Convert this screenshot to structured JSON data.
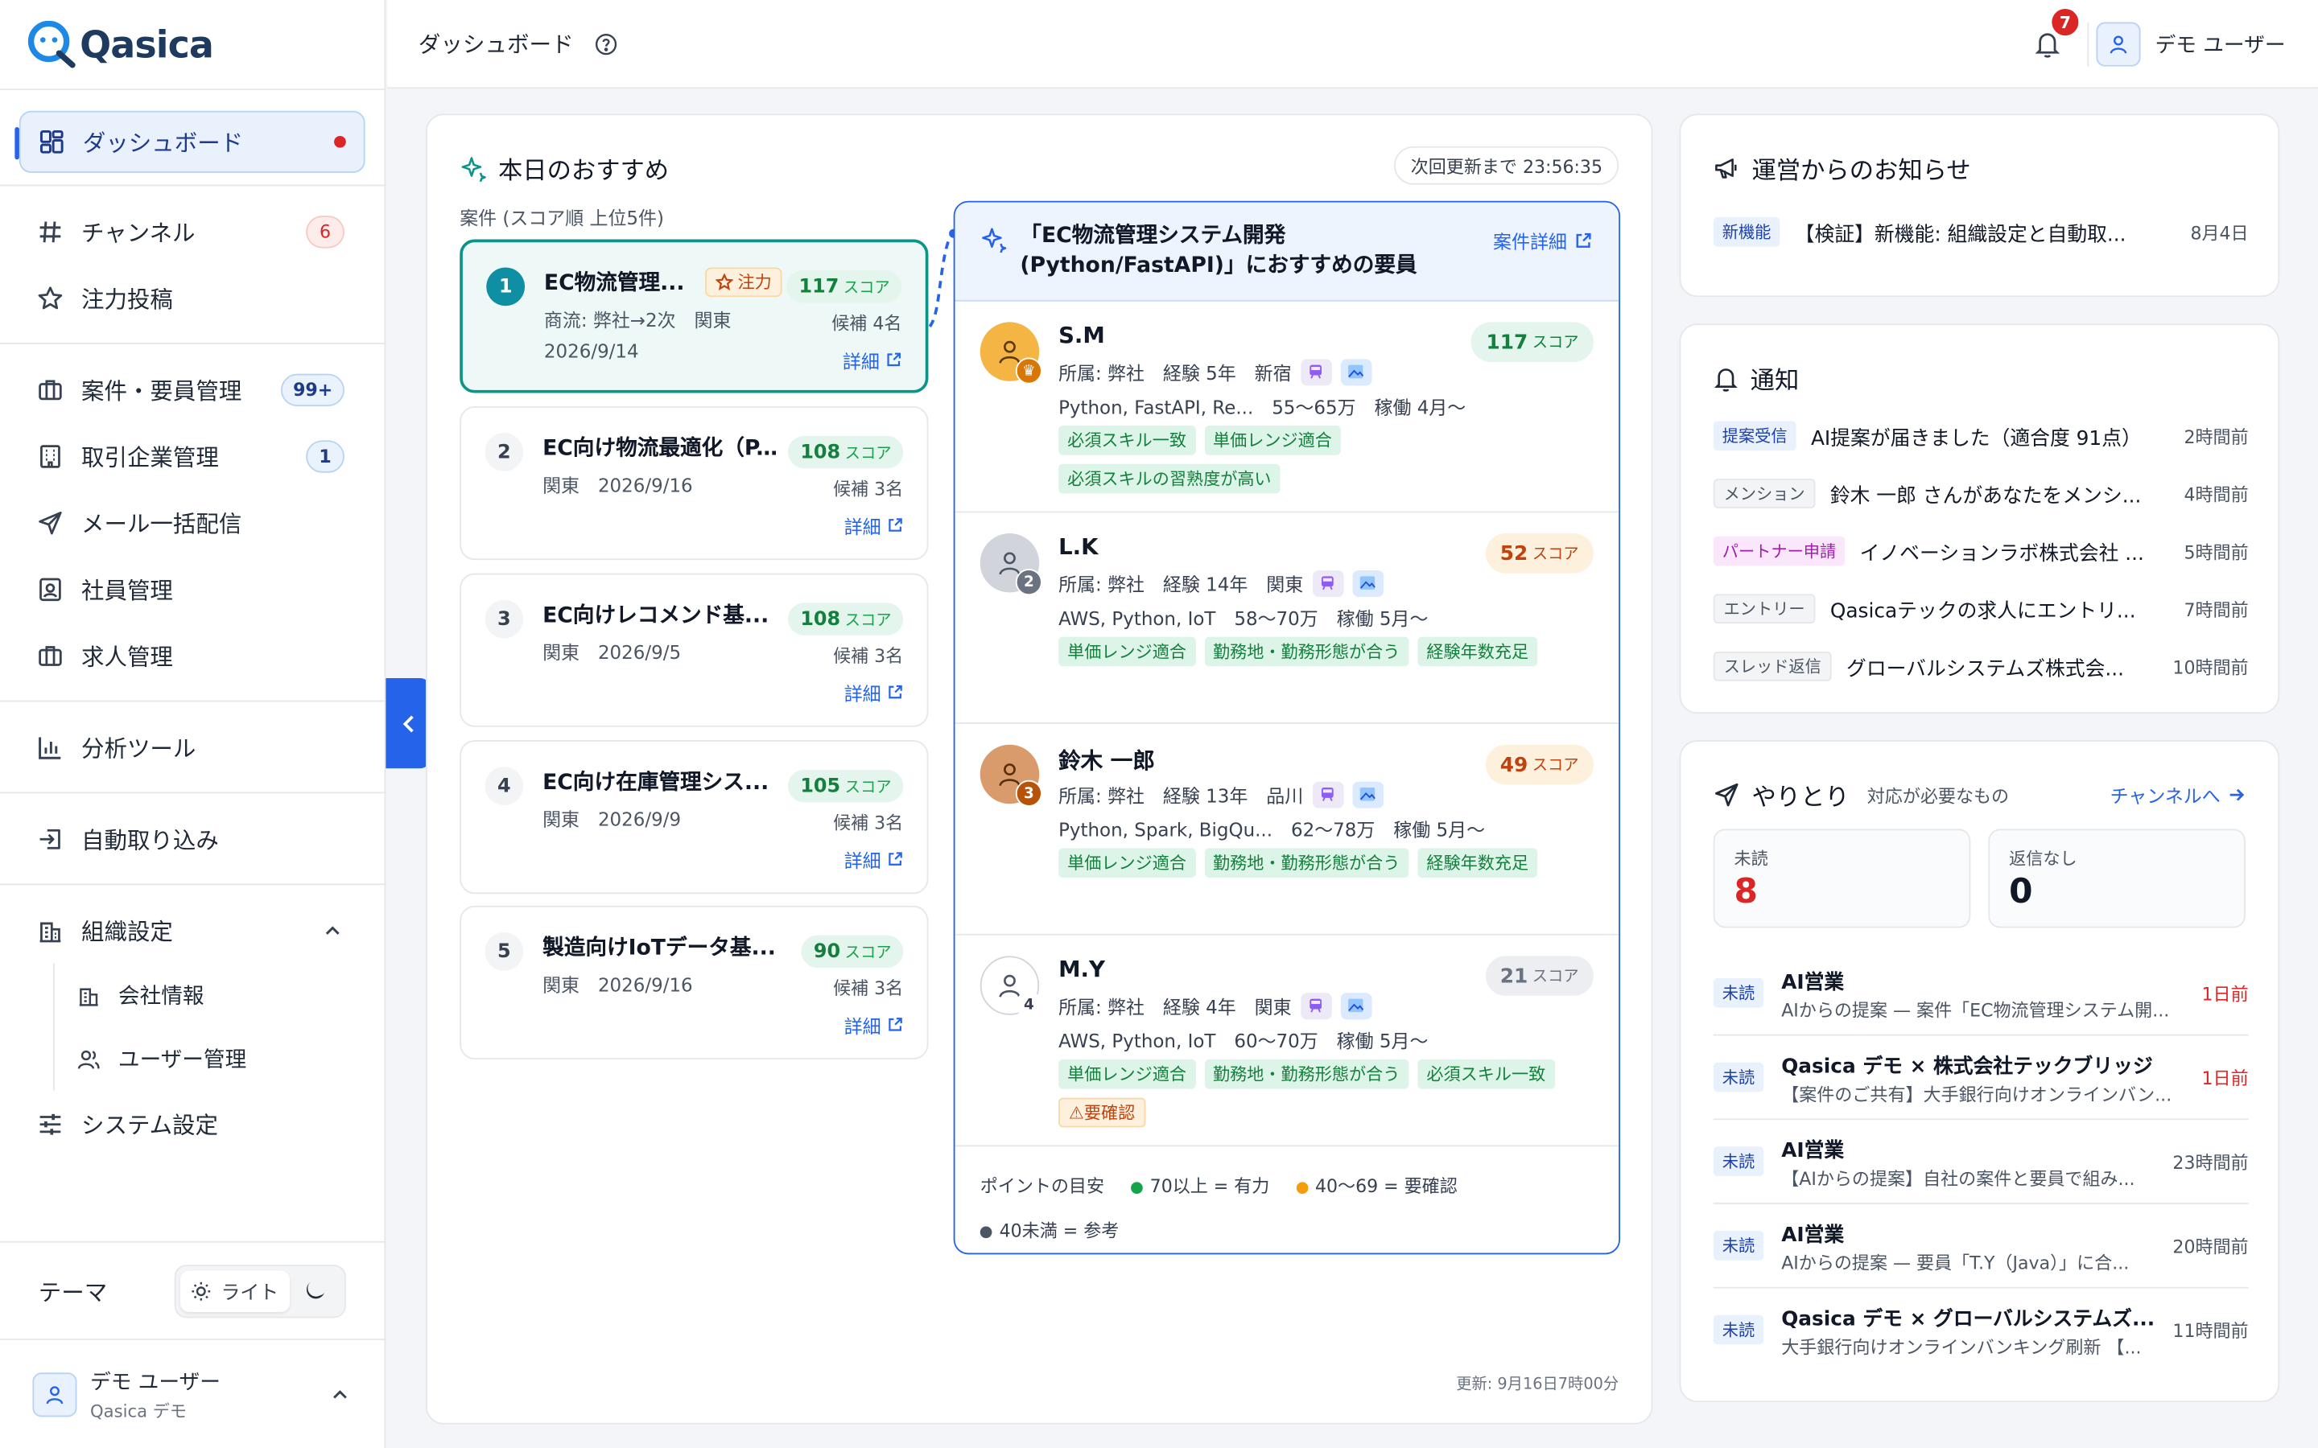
{
  "brand": {
    "name": "Qasica"
  },
  "header": {
    "title": "ダッシュボード",
    "notification_count": "7",
    "user_name": "デモ ユーザー"
  },
  "sidebar": {
    "active": {
      "label": "ダッシュボード"
    },
    "items": [
      {
        "label": "チャンネル",
        "badge": "6"
      },
      {
        "label": "注力投稿"
      },
      {
        "label": "案件・要員管理",
        "badge": "99+"
      },
      {
        "label": "取引企業管理",
        "badge": "1"
      },
      {
        "label": "メール一括配信"
      },
      {
        "label": "社員管理"
      },
      {
        "label": "求人管理"
      },
      {
        "label": "分析ツール"
      },
      {
        "label": "自動取り込み"
      },
      {
        "label": "組織設定"
      },
      {
        "label": "会社情報"
      },
      {
        "label": "ユーザー管理"
      },
      {
        "label": "システム設定"
      }
    ],
    "theme_label": "テーマ",
    "theme_light": "ライト",
    "user": {
      "name": "デモ ユーザー",
      "org": "Qasica デモ"
    }
  },
  "reco": {
    "title": "本日のおすすめ",
    "timer": "次回更新まで 23:56:35",
    "list_caption": "案件 (スコア順 上位5件)",
    "detail_label": "詳細",
    "score_unit": "スコア",
    "focus_label": "注力",
    "cases": [
      {
        "num": "1",
        "title": "EC物流管理...",
        "meta": "商流: 弊社→2次　関東",
        "date": "2026/9/14",
        "score": "117",
        "count": "候補 4名"
      },
      {
        "num": "2",
        "title": "EC向け物流最適化（P...",
        "meta": "関東　2026/9/16",
        "score": "108",
        "count": "候補 3名"
      },
      {
        "num": "3",
        "title": "EC向けレコメンド基...",
        "meta": "関東　2026/9/5",
        "score": "108",
        "count": "候補 3名"
      },
      {
        "num": "4",
        "title": "EC向け在庫管理シス...",
        "meta": "関東　2026/9/9",
        "score": "105",
        "count": "候補 3名"
      },
      {
        "num": "5",
        "title": "製造向けIoTデータ基...",
        "meta": "関東　2026/9/16",
        "score": "90",
        "count": "候補 3名"
      }
    ],
    "panel": {
      "title_line1": "「EC物流管理システム開発",
      "title_line2": "(Python/FastAPI)」におすすめの要員",
      "link": "案件詳細",
      "candidates": [
        {
          "name": "S.M",
          "line1": "所属: 弊社　経験 5年　新宿",
          "line2": "Python, FastAPI, Re...　55〜65万　稼働 4月〜",
          "score": "117",
          "rank": "♛",
          "tags": [
            "必須スキル一致",
            "単価レンジ適合",
            "必須スキルの習熟度が高い"
          ]
        },
        {
          "name": "L.K",
          "line1": "所属: 弊社　経験 14年　関東",
          "line2": "AWS, Python, IoT　58〜70万　稼働 5月〜",
          "score": "52",
          "rank": "2",
          "tags": [
            "単価レンジ適合",
            "勤務地・勤務形態が合う",
            "経験年数充足"
          ]
        },
        {
          "name": "鈴木 一郎",
          "line1": "所属: 弊社　経験 13年　品川",
          "line2": "Python, Spark, BigQu...　62〜78万　稼働 5月〜",
          "score": "49",
          "rank": "3",
          "tags": [
            "単価レンジ適合",
            "勤務地・勤務形態が合う",
            "経験年数充足"
          ]
        },
        {
          "name": "M.Y",
          "line1": "所属: 弊社　経験 4年　関東",
          "line2": "AWS, Python, IoT　60〜70万　稼働 5月〜",
          "score": "21",
          "rank": "4",
          "tags": [
            "単価レンジ適合",
            "勤務地・勤務形態が合う",
            "必須スキル一致"
          ],
          "warn_tag": "⚠要確認"
        }
      ],
      "legend_title": "ポイントの目安",
      "legend": [
        "70以上 = 有力",
        "40〜69 = 要確認",
        "40未満 = 参考"
      ]
    },
    "updated": "更新: 9月16日7時00分"
  },
  "news": {
    "title": "運営からのお知らせ",
    "items": [
      {
        "tag": "新機能",
        "text": "【検証】新機能: 組織設定と自動取...",
        "time": "8月4日"
      }
    ]
  },
  "notifications": {
    "title": "通知",
    "items": [
      {
        "tag": "提案受信",
        "text": "AI提案が届きました（適合度 91点）",
        "time": "2時間前"
      },
      {
        "tag": "メンション",
        "text": "鈴木 一郎 さんがあなたをメンシ...",
        "time": "4時間前"
      },
      {
        "tag": "パートナー申請",
        "text": "イノベーションラボ株式会社 ...",
        "time": "5時間前"
      },
      {
        "tag": "エントリー",
        "text": "Qasicaテックの求人にエントリ...",
        "time": "7時間前"
      },
      {
        "tag": "スレッド返信",
        "text": "グローバルシステムズ株式会...",
        "time": "10時間前"
      }
    ]
  },
  "exchange": {
    "title": "やりとり",
    "subtitle": "対応が必要なもの",
    "link": "チャンネルへ",
    "unread_label": "未読",
    "unread_value": "8",
    "noreply_label": "返信なし",
    "noreply_value": "0",
    "tag": "未読",
    "messages": [
      {
        "title": "AI営業",
        "sub": "AIからの提案 — 案件「EC物流管理システム開...",
        "time": "1日前"
      },
      {
        "title": "Qasica デモ × 株式会社テックブリッジ",
        "sub": "【案件のご共有】大手銀行向けオンラインバン...",
        "time": "1日前"
      },
      {
        "title": "AI営業",
        "sub": "【AIからの提案】自社の案件と要員で組み...",
        "time": "23時間前"
      },
      {
        "title": "AI営業",
        "sub": "AIからの提案 — 要員「T.Y（Java）」に合...",
        "time": "20時間前"
      },
      {
        "title": "Qasica デモ × グローバルシステムズ...",
        "sub": "大手銀行向けオンラインバンキング刷新 【...",
        "time": "11時間前"
      }
    ]
  },
  "colors": {
    "accent": "#2563eb",
    "teal": "#0d9488",
    "danger": "#dc2626",
    "score_green": "#15803d",
    "score_orange": "#c2410c"
  }
}
